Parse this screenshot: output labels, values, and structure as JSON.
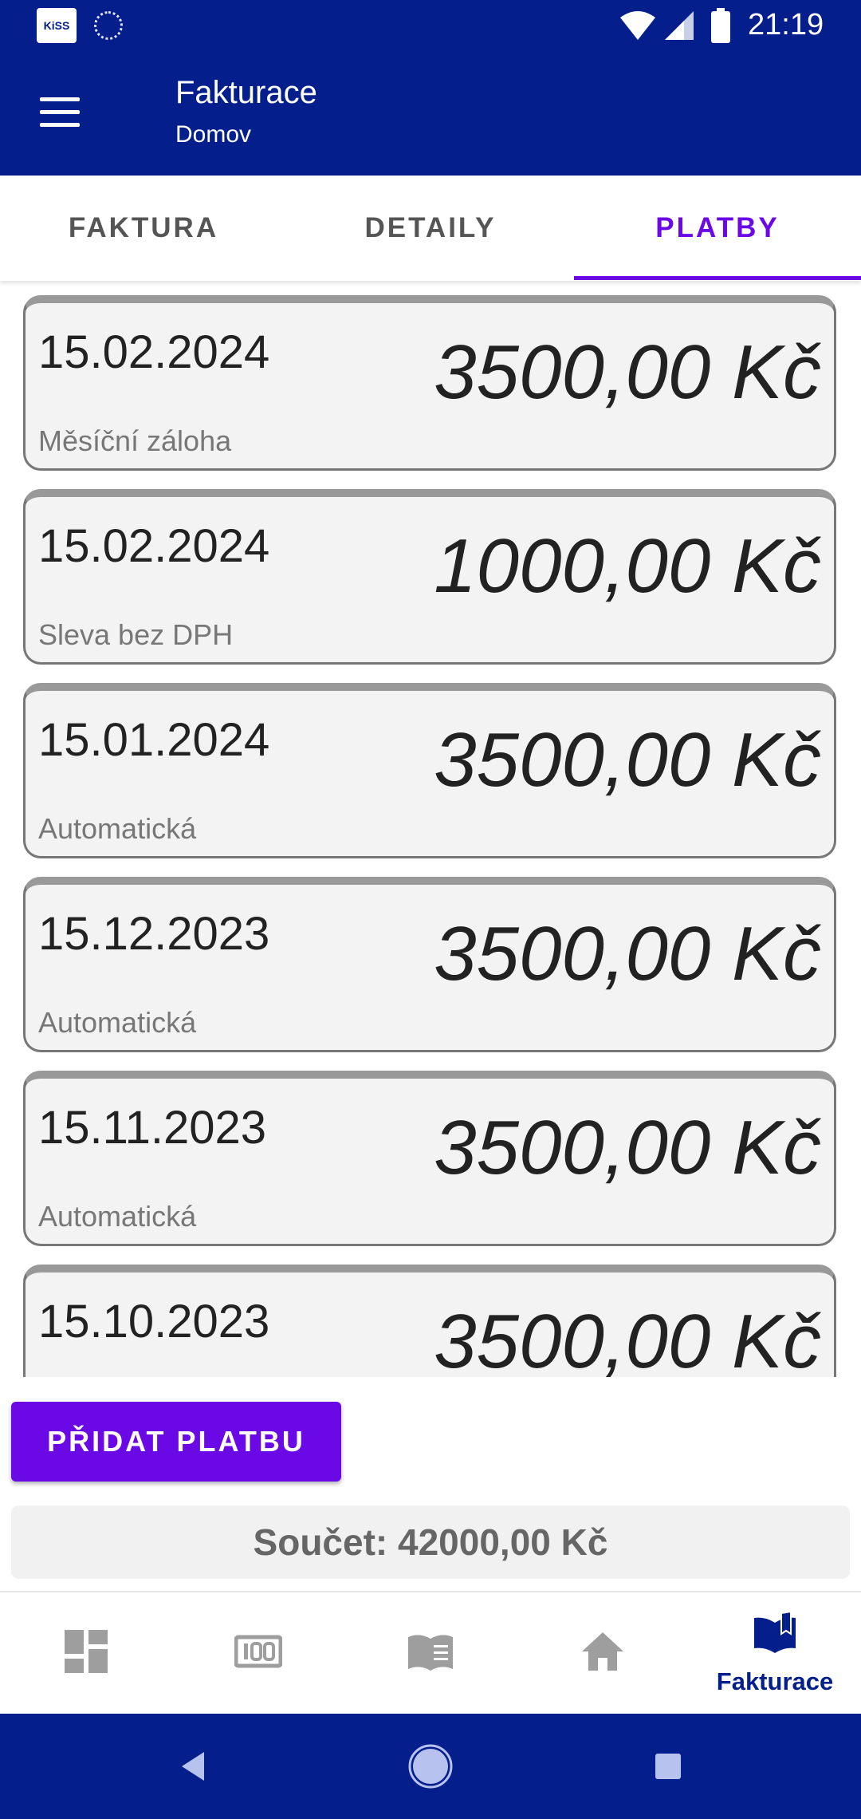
{
  "status_bar": {
    "time": "21:19",
    "app_badge": "KiSS"
  },
  "app_bar": {
    "title": "Fakturace",
    "subtitle": "Domov"
  },
  "tabs": [
    {
      "label": "FAKTURA",
      "active": false
    },
    {
      "label": "DETAILY",
      "active": false
    },
    {
      "label": "PLATBY",
      "active": true
    }
  ],
  "payments": [
    {
      "date": "15.02.2024",
      "amount": "3500,00 Kč",
      "note": "Měsíční záloha"
    },
    {
      "date": "15.02.2024",
      "amount": "1000,00 Kč",
      "note": "Sleva bez DPH"
    },
    {
      "date": "15.01.2024",
      "amount": "3500,00 Kč",
      "note": "Automatická"
    },
    {
      "date": "15.12.2023",
      "amount": "3500,00 Kč",
      "note": "Automatická"
    },
    {
      "date": "15.11.2023",
      "amount": "3500,00 Kč",
      "note": "Automatická"
    },
    {
      "date": "15.10.2023",
      "amount": "3500,00 Kč",
      "note": ""
    }
  ],
  "actions": {
    "add_payment": "PŘIDAT PLATBU"
  },
  "summary": {
    "text": "Součet: 42000,00 Kč"
  },
  "bottom_nav": {
    "items": [
      {
        "icon": "dashboard-icon",
        "label": ""
      },
      {
        "icon": "meter-counter-icon",
        "label": ""
      },
      {
        "icon": "book-list-icon",
        "label": ""
      },
      {
        "icon": "home-icon",
        "label": ""
      },
      {
        "icon": "open-book-icon",
        "label": "Fakturace",
        "active": true
      }
    ]
  },
  "colors": {
    "primary": "#041E8C",
    "accent": "#6B09E6",
    "card_background": "#F3F3F3",
    "inactive_icon": "#9E9E9E"
  }
}
